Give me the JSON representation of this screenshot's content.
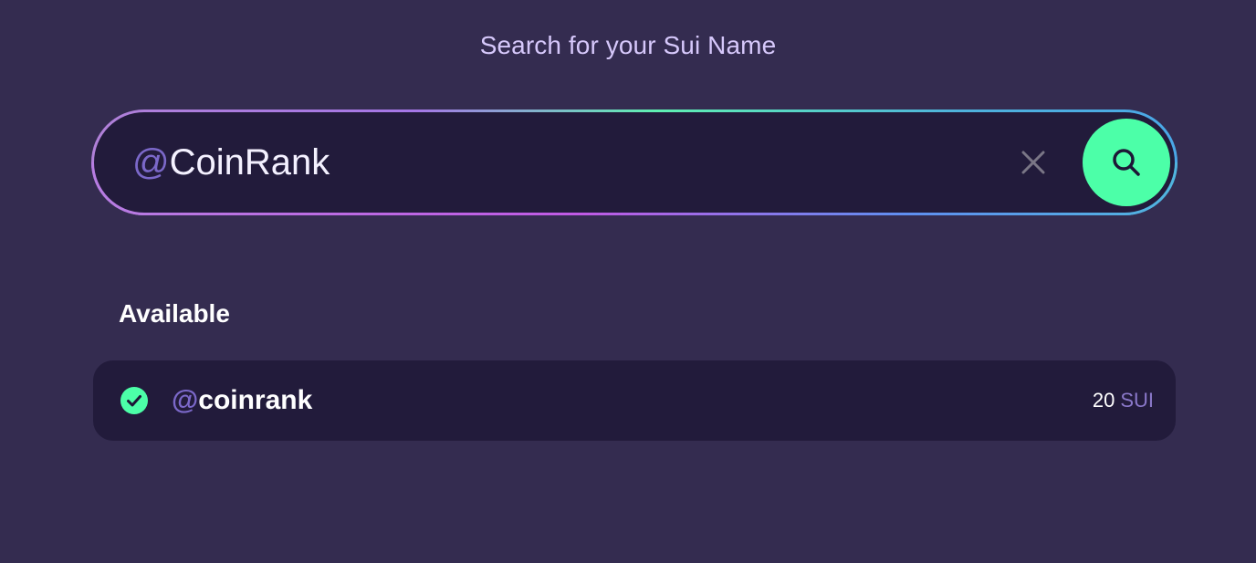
{
  "page": {
    "heading": "Search for your Sui Name"
  },
  "search": {
    "prefix": "@",
    "query": "CoinRank",
    "clear_icon": "close-icon",
    "search_icon": "search-icon"
  },
  "results": {
    "section_label": "Available",
    "items": [
      {
        "status_icon": "check-circle-icon",
        "prefix": "@",
        "name": "coinrank",
        "price": "20",
        "currency": "SUI"
      }
    ]
  },
  "colors": {
    "background": "#342c50",
    "panel": "#221b3b",
    "accent_green": "#4cffa8",
    "accent_purple": "#7b68c9",
    "heading_text": "#d6c8fb"
  }
}
